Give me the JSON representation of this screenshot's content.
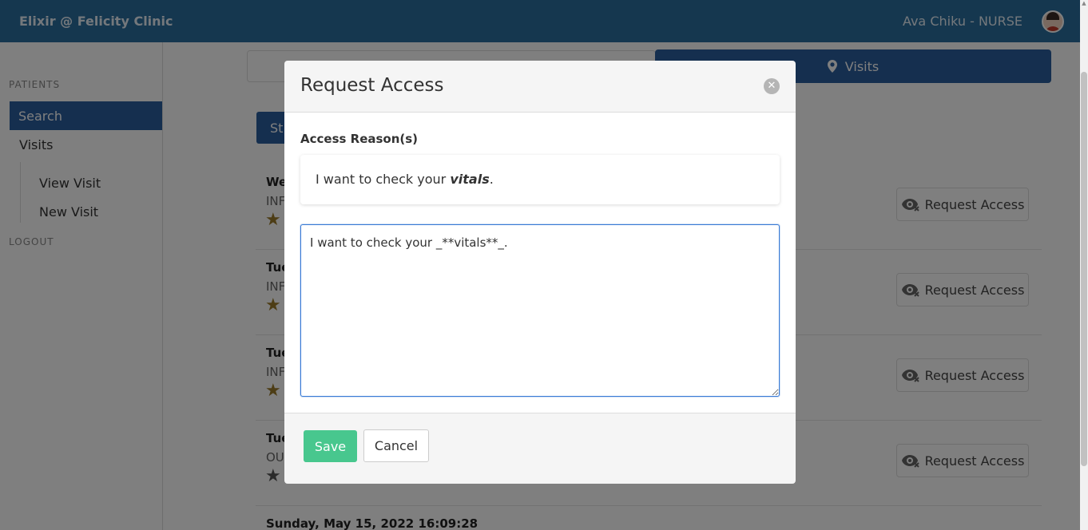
{
  "header": {
    "brand": "Elixir @ Felicity Clinic",
    "user": "Ava Chiku - NURSE"
  },
  "sidebar": {
    "heading_patients": "PATIENTS",
    "items": [
      {
        "label": "Search",
        "active": true
      },
      {
        "label": "Visits",
        "active": false
      }
    ],
    "sub_items": [
      {
        "label": "View Visit"
      },
      {
        "label": "New Visit"
      }
    ],
    "heading_logout": "LOGOUT"
  },
  "main": {
    "tab_visits": "Visits",
    "tab_visits_icon": "map-marker-icon",
    "start_label": "St",
    "visits": [
      {
        "date": "We",
        "type": "INF",
        "star_color": "#9a7a2a",
        "request_label": "Request Access"
      },
      {
        "date": "Tue",
        "type": "INF",
        "star_color": "#9a7a2a",
        "request_label": "Request Access"
      },
      {
        "date": "Tue",
        "type": "INF",
        "star_color": "#9a7a2a",
        "request_label": "Request Access"
      },
      {
        "date": "Tue",
        "type": "OU",
        "star_color": "#555555",
        "request_label": "Request Access"
      }
    ],
    "last_visit_date": "Sunday, May 15, 2022 16:09:28"
  },
  "modal": {
    "title": "Request Access",
    "close_icon": "close-icon",
    "reason_label": "Access Reason(s)",
    "preview_prefix": "I want to check your ",
    "preview_emphasis": "vitals",
    "preview_suffix": ".",
    "textarea_value": "I want to check your _**vitals**_.",
    "save_label": "Save",
    "cancel_label": "Cancel"
  },
  "colors": {
    "brand": "#2b6f9e",
    "primary": "#2b5f9e",
    "success": "#48c78e",
    "focus": "#3a7bd5"
  }
}
